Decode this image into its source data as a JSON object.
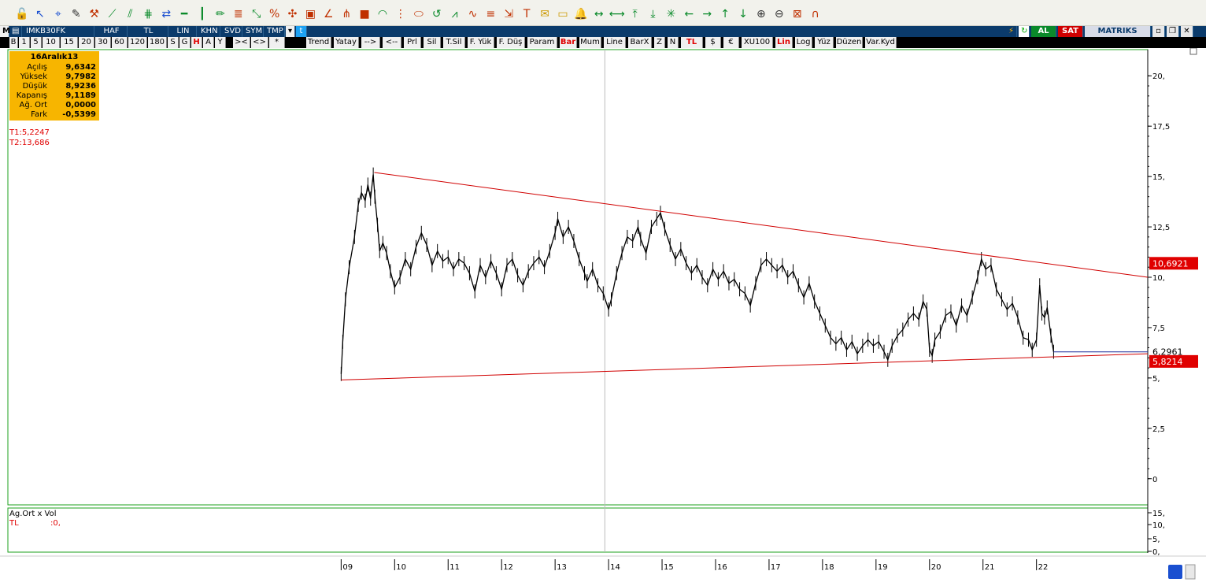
{
  "toolbar": {
    "icons": [
      "lock-open-icon",
      "cursor-arrow-icon",
      "crosshair-icon",
      "edit-icon",
      "hammer-icon",
      "trend-line-icon",
      "channel-icon",
      "parallel-lines-icon",
      "arrows-icon",
      "horizontal-line-icon",
      "vertical-line-icon",
      "pencil-icon",
      "fibo-icon",
      "regression-icon",
      "percent-icon",
      "gann-icon",
      "box-icon",
      "angle-icon",
      "fan-icon",
      "square-icon",
      "arc-icon",
      "time-zone-icon",
      "ellipse-icon",
      "cycle-icon",
      "speed-line-icon",
      "wave-icon",
      "retracement-icon",
      "extension-icon",
      "text-icon",
      "callout-icon",
      "note-icon",
      "bell-icon",
      "move-horizontal-icon",
      "resize-horizontal-icon",
      "collapse-vertical-icon",
      "expand-vertical-icon",
      "snowflake-icon",
      "arrow-left-icon",
      "arrow-right-icon",
      "arrow-up-icon",
      "arrow-down-icon",
      "zoom-in-icon",
      "zoom-out-icon",
      "close-chart-icon",
      "magnet-icon"
    ]
  },
  "header": {
    "symbol": "IMKB30FK",
    "period": "HAF",
    "currency": "TL",
    "scale": "LIN",
    "khn": "KHN",
    "svd": "SVD",
    "sym": "SYM",
    "tmp": "TMP",
    "buy": "AL",
    "sell": "SAT",
    "brand": "MATRIKS"
  },
  "periods": [
    "B",
    "1",
    "5",
    "10",
    "15",
    "20",
    "30",
    "60",
    "120",
    "180",
    "S",
    "G",
    "H",
    "A",
    "Y"
  ],
  "nav": [
    "><",
    "<>",
    "*"
  ],
  "tools": [
    "Trend",
    "Yatay",
    "-->",
    "<--",
    "Prl",
    "Sil",
    "T.Sil",
    "F. Yük",
    "F. Düş",
    "Param",
    "Bar",
    "Mum",
    "Line",
    "BarX",
    "Z",
    "N",
    "TL",
    "$",
    "€",
    "XU100",
    "Lin",
    "Log",
    "Yüz",
    "Düzen",
    "Var.Kyd"
  ],
  "info": {
    "date": "16Aralık13",
    "rows": [
      {
        "k": "Açılış",
        "v": "9,6342"
      },
      {
        "k": "Yüksek",
        "v": "9,7982"
      },
      {
        "k": "Düşük",
        "v": "8,9236"
      },
      {
        "k": "Kapanış",
        "v": "9,1189"
      },
      {
        "k": "Ağ. Ort",
        "v": "0,0000"
      },
      {
        "k": "Fark",
        "v": "-0,5399"
      }
    ],
    "t1": "T1:5,2247",
    "t2": "T2:13,686"
  },
  "sub_panel": {
    "title": "Ag.Ort x Vol",
    "tl_label": "TL",
    "tl_value": ":0,",
    "y_ticks": [
      "15,",
      "10,",
      "5,",
      "0,"
    ]
  },
  "chart_data": {
    "type": "line",
    "series": [
      {
        "values_ref": "weekly close"
      }
    ],
    "y_ticks": [
      "20,",
      "17,5",
      "15,",
      "12,5",
      "10,",
      "7,5",
      "5,",
      "2,5",
      "0"
    ],
    "y_ticks_values": [
      20,
      17.5,
      15,
      12.5,
      10,
      7.5,
      5,
      2.5,
      0
    ],
    "ylim": [
      -1.3,
      21.3
    ],
    "x_ticks": [
      "09",
      "10",
      "11",
      "12",
      "13",
      "14",
      "15",
      "16",
      "17",
      "18",
      "19",
      "20",
      "21",
      "22"
    ],
    "x_ticks_years": [
      2009,
      2010,
      2011,
      2012,
      2013,
      2014,
      2015,
      2016,
      2017,
      2018,
      2019,
      2020,
      2021,
      2022
    ],
    "xlim_year": [
      2008.98,
      2024.08
    ],
    "prices": [
      [
        2009.0,
        5.2
      ],
      [
        2009.03,
        6.8
      ],
      [
        2009.08,
        8.9
      ],
      [
        2009.15,
        10.5
      ],
      [
        2009.25,
        12.0
      ],
      [
        2009.32,
        13.6
      ],
      [
        2009.38,
        14.2
      ],
      [
        2009.45,
        13.8
      ],
      [
        2009.5,
        14.6
      ],
      [
        2009.55,
        13.9
      ],
      [
        2009.6,
        15.1
      ],
      [
        2009.63,
        14.0
      ],
      [
        2009.68,
        12.6
      ],
      [
        2009.72,
        11.3
      ],
      [
        2009.78,
        11.7
      ],
      [
        2009.85,
        11.2
      ],
      [
        2009.92,
        10.3
      ],
      [
        2010.0,
        9.5
      ],
      [
        2010.1,
        10.0
      ],
      [
        2010.2,
        10.9
      ],
      [
        2010.3,
        10.4
      ],
      [
        2010.4,
        11.5
      ],
      [
        2010.5,
        12.2
      ],
      [
        2010.6,
        11.6
      ],
      [
        2010.7,
        10.6
      ],
      [
        2010.8,
        11.3
      ],
      [
        2010.9,
        10.8
      ],
      [
        2011.0,
        11.0
      ],
      [
        2011.1,
        10.4
      ],
      [
        2011.2,
        10.9
      ],
      [
        2011.3,
        10.7
      ],
      [
        2011.4,
        10.2
      ],
      [
        2011.5,
        9.3
      ],
      [
        2011.6,
        10.6
      ],
      [
        2011.7,
        10.0
      ],
      [
        2011.8,
        10.8
      ],
      [
        2011.9,
        10.2
      ],
      [
        2012.0,
        9.4
      ],
      [
        2012.1,
        10.6
      ],
      [
        2012.2,
        10.9
      ],
      [
        2012.3,
        10.1
      ],
      [
        2012.4,
        9.6
      ],
      [
        2012.5,
        10.3
      ],
      [
        2012.6,
        10.7
      ],
      [
        2012.7,
        11.0
      ],
      [
        2012.8,
        10.5
      ],
      [
        2012.9,
        11.3
      ],
      [
        2013.0,
        12.2
      ],
      [
        2013.05,
        12.9
      ],
      [
        2013.15,
        12.0
      ],
      [
        2013.25,
        12.5
      ],
      [
        2013.35,
        11.8
      ],
      [
        2013.45,
        10.9
      ],
      [
        2013.55,
        10.2
      ],
      [
        2013.6,
        9.8
      ],
      [
        2013.7,
        10.4
      ],
      [
        2013.8,
        9.6
      ],
      [
        2013.9,
        9.2
      ],
      [
        2014.0,
        8.4
      ],
      [
        2014.05,
        8.9
      ],
      [
        2014.15,
        10.2
      ],
      [
        2014.25,
        11.2
      ],
      [
        2014.35,
        12.0
      ],
      [
        2014.45,
        11.8
      ],
      [
        2014.55,
        12.5
      ],
      [
        2014.6,
        11.9
      ],
      [
        2014.7,
        11.2
      ],
      [
        2014.8,
        12.5
      ],
      [
        2014.9,
        12.9
      ],
      [
        2014.97,
        13.2
      ],
      [
        2015.05,
        12.4
      ],
      [
        2015.15,
        11.6
      ],
      [
        2015.25,
        10.9
      ],
      [
        2015.35,
        11.4
      ],
      [
        2015.45,
        10.7
      ],
      [
        2015.55,
        10.2
      ],
      [
        2015.65,
        10.6
      ],
      [
        2015.75,
        10.0
      ],
      [
        2015.85,
        9.6
      ],
      [
        2015.95,
        10.4
      ],
      [
        2016.05,
        9.9
      ],
      [
        2016.15,
        10.3
      ],
      [
        2016.25,
        9.7
      ],
      [
        2016.35,
        9.9
      ],
      [
        2016.45,
        9.4
      ],
      [
        2016.55,
        9.2
      ],
      [
        2016.65,
        8.6
      ],
      [
        2016.75,
        9.7
      ],
      [
        2016.85,
        10.6
      ],
      [
        2016.95,
        10.9
      ],
      [
        2017.05,
        10.6
      ],
      [
        2017.15,
        10.3
      ],
      [
        2017.25,
        10.6
      ],
      [
        2017.35,
        10.0
      ],
      [
        2017.45,
        10.3
      ],
      [
        2017.55,
        9.6
      ],
      [
        2017.65,
        9.0
      ],
      [
        2017.75,
        9.7
      ],
      [
        2017.85,
        8.8
      ],
      [
        2017.95,
        8.2
      ],
      [
        2018.05,
        7.6
      ],
      [
        2018.15,
        7.0
      ],
      [
        2018.25,
        6.7
      ],
      [
        2018.35,
        7.0
      ],
      [
        2018.45,
        6.4
      ],
      [
        2018.55,
        6.8
      ],
      [
        2018.65,
        6.2
      ],
      [
        2018.75,
        6.6
      ],
      [
        2018.85,
        6.9
      ],
      [
        2018.95,
        6.6
      ],
      [
        2019.05,
        6.8
      ],
      [
        2019.15,
        6.3
      ],
      [
        2019.22,
        5.9
      ],
      [
        2019.3,
        6.6
      ],
      [
        2019.4,
        7.1
      ],
      [
        2019.5,
        7.4
      ],
      [
        2019.6,
        7.9
      ],
      [
        2019.7,
        8.2
      ],
      [
        2019.8,
        7.9
      ],
      [
        2019.88,
        8.8
      ],
      [
        2019.95,
        8.4
      ],
      [
        2020.0,
        6.4
      ],
      [
        2020.05,
        6.1
      ],
      [
        2020.1,
        6.9
      ],
      [
        2020.2,
        7.3
      ],
      [
        2020.3,
        8.1
      ],
      [
        2020.4,
        8.3
      ],
      [
        2020.5,
        7.6
      ],
      [
        2020.6,
        8.6
      ],
      [
        2020.7,
        8.1
      ],
      [
        2020.8,
        9.0
      ],
      [
        2020.9,
        10.0
      ],
      [
        2020.97,
        10.9
      ],
      [
        2021.05,
        10.4
      ],
      [
        2021.15,
        10.6
      ],
      [
        2021.25,
        9.4
      ],
      [
        2021.35,
        8.9
      ],
      [
        2021.45,
        8.4
      ],
      [
        2021.55,
        8.7
      ],
      [
        2021.65,
        8.0
      ],
      [
        2021.75,
        7.0
      ],
      [
        2021.85,
        6.9
      ],
      [
        2021.92,
        6.4
      ],
      [
        2022.0,
        6.9
      ],
      [
        2022.06,
        9.6
      ],
      [
        2022.1,
        8.2
      ],
      [
        2022.15,
        8.0
      ],
      [
        2022.2,
        8.5
      ],
      [
        2022.27,
        7.1
      ],
      [
        2022.32,
        6.3
      ]
    ],
    "trend_upper": {
      "from": [
        2009.62,
        15.2
      ],
      "to": [
        2024.08,
        10.0
      ]
    },
    "trend_lower": {
      "from": [
        2009.0,
        4.9
      ],
      "to": [
        2024.08,
        6.2
      ]
    },
    "hline": {
      "from_year": 2022.32,
      "value": 6.2961
    },
    "price_labels": [
      {
        "text": "10,6921",
        "value": 10.6921,
        "style": "red"
      },
      {
        "text": "6,2961",
        "value": 6.2961,
        "style": "plain"
      },
      {
        "text": "5,8214",
        "value": 5.8214,
        "style": "red"
      }
    ],
    "crosshair_year": 2013.93
  }
}
